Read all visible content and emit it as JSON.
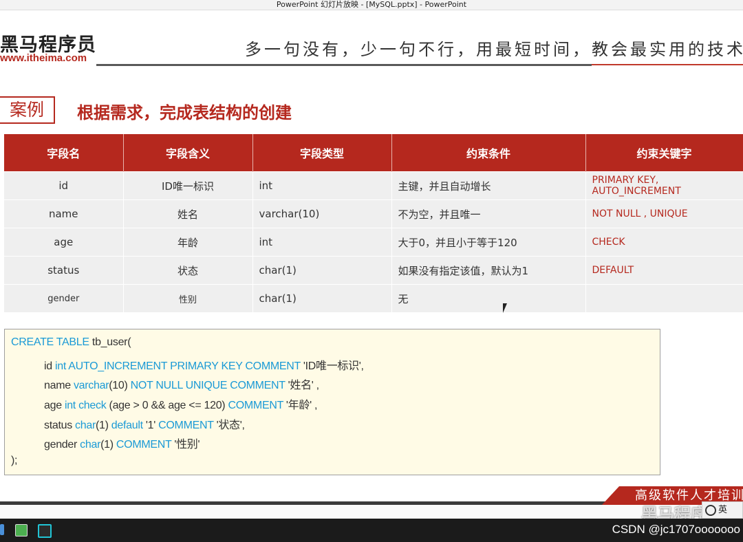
{
  "window": {
    "title": "PowerPoint 幻灯片放映 - [MySQL.pptx] - PowerPoint"
  },
  "header": {
    "logo_text": "黑马程序员",
    "logo_url": "www.itheima.com",
    "slogan": "多一句没有，少一句不行，用最短时间，教会最实用的技术"
  },
  "section": {
    "tag": "案例",
    "title": "根据需求，完成表结构的创建"
  },
  "table": {
    "headers": [
      "字段名",
      "字段含义",
      "字段类型",
      "约束条件",
      "约束关键字"
    ],
    "rows": [
      [
        "id",
        "ID唯一标识",
        "int",
        "主键，并且自动增长",
        "PRIMARY KEY, AUTO_INCREMENT"
      ],
      [
        "name",
        "姓名",
        "varchar(10)",
        "不为空，并且唯一",
        "NOT  NULL , UNIQUE"
      ],
      [
        "age",
        "年龄",
        "int",
        "大于0，并且小于等于120",
        "CHECK"
      ],
      [
        "status",
        "状态",
        "char(1)",
        "如果没有指定该值，默认为1",
        "DEFAULT"
      ],
      [
        "gender",
        "性别",
        "char(1)",
        "无",
        ""
      ]
    ]
  },
  "code": {
    "line1": [
      "CREATE TABLE",
      " tb_user("
    ],
    "line2": [
      "id ",
      "int AUTO_INCREMENT PRIMARY KEY  COMMENT",
      "  'ID唯一标识',"
    ],
    "line3": [
      "name ",
      "varchar",
      "(10) ",
      "NOT NULL UNIQUE  COMMENT",
      "  '姓名' ,"
    ],
    "line4": [
      "age ",
      "int check",
      " (age > 0 && age <= 120)  ",
      "COMMENT",
      "  '年龄' ,"
    ],
    "line5": [
      "status ",
      "char",
      "(1) ",
      "default",
      "  '1'  ",
      "COMMENT",
      "  '状态',"
    ],
    "line6": [
      "gender ",
      "char",
      "(1)  ",
      "COMMENT",
      "  '性别'"
    ],
    "line7": ");"
  },
  "footer": {
    "banner": "高级软件人才培训专家",
    "watermark": "黑马程序员",
    "ime_label": "英"
  },
  "taskbar": {
    "watermark": "CSDN @jc1707ooooooo"
  },
  "colors": {
    "brand_red": "#b5281e",
    "keyword_blue": "#1a9ad6",
    "code_bg": "#fffbe6"
  }
}
